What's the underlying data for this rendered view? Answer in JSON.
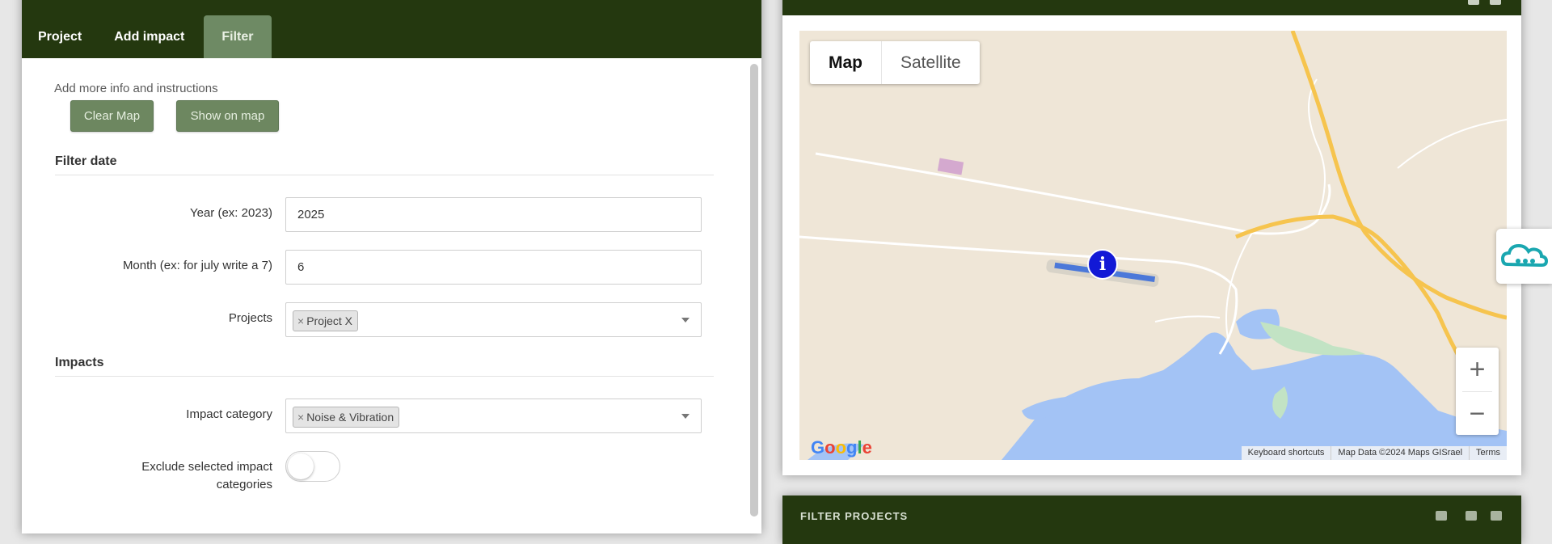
{
  "left_panel": {
    "tabs": [
      {
        "label": "Project",
        "active": false
      },
      {
        "label": "Add impact",
        "active": false
      },
      {
        "label": "Filter",
        "active": true
      }
    ],
    "helper_text": "Add more info and instructions",
    "buttons": {
      "clear_map": "Clear Map",
      "show_on_map": "Show on map"
    },
    "filter_date": {
      "title": "Filter date",
      "year": {
        "label": "Year (ex: 2023)",
        "value": "2025"
      },
      "month": {
        "label": "Month (ex: for july write a 7)",
        "value": "6"
      },
      "projects": {
        "label": "Projects",
        "selected": [
          "Project X"
        ]
      }
    },
    "impacts": {
      "title": "Impacts",
      "impact_category": {
        "label": "Impact category",
        "selected": [
          "Noise & Vibration"
        ]
      },
      "exclude_toggle": {
        "label_line1": "Exclude selected impact",
        "label_line2": "categories",
        "on": false
      }
    },
    "chip_remove_symbol": "×"
  },
  "map_panel": {
    "map_type": {
      "map": "Map",
      "satellite": "Satellite",
      "selected": "Map"
    },
    "zoom": {
      "in": "+",
      "out": "−"
    },
    "logo": "Google",
    "footer": {
      "shortcuts": "Keyboard shortcuts",
      "attribution": "Map Data ©2024 Maps GISrael",
      "terms": "Terms"
    },
    "marker_icon": "info-icon",
    "marker_symbol": "i"
  },
  "filter_projects_panel": {
    "title": "FILTER PROJECTS"
  },
  "cloud_button": {
    "icon": "cloud-icon"
  },
  "colors": {
    "header_green": "#24380f",
    "button_green": "#6d8760",
    "map_land": "#efe6d7",
    "map_water": "#a3c3f5",
    "map_park": "#c2e3c4",
    "road_yellow": "#f6c44e",
    "marker_blue": "#1219d6",
    "cloud_teal": "#1aa7b0"
  }
}
